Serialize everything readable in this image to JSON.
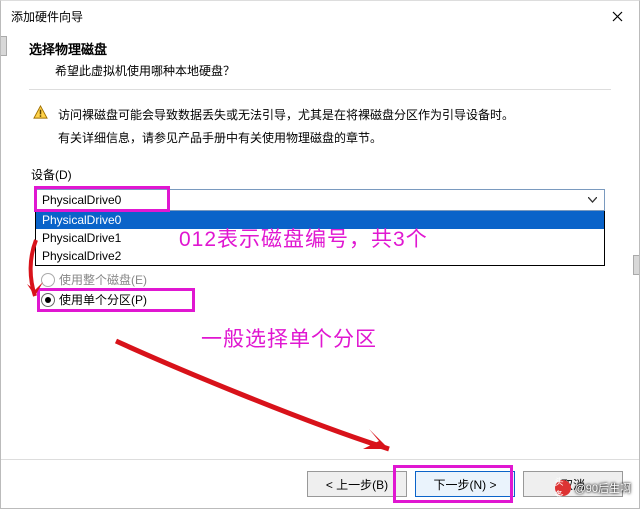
{
  "window": {
    "title": "添加硬件向导"
  },
  "header": {
    "heading": "选择物理磁盘",
    "subheading": "希望此虚拟机使用哪种本地硬盘？"
  },
  "warning": {
    "line1": "访问裸磁盘可能会导致数据丢失或无法引导，尤其是在将裸磁盘分区作为引导设备时。",
    "line2": "有关详细信息，请参见产品手册中有关使用物理磁盘的章节。"
  },
  "device": {
    "label": "设备(D)",
    "selected": "PhysicalDrive0",
    "options": [
      "PhysicalDrive0",
      "PhysicalDrive1",
      "PhysicalDrive2"
    ]
  },
  "usage": {
    "entire_label": "使用整个磁盘(E)",
    "single_label": "使用单个分区(P)",
    "selected": "single"
  },
  "annotations": {
    "combo_note": "012表示磁盘编号，共3个",
    "radio_note": "一般选择单个分区"
  },
  "footer": {
    "back": "< 上一步(B)",
    "next": "下一步(N) >",
    "cancel": "取消"
  },
  "watermark": {
    "icon_text": "头条",
    "author": "@90后生啊"
  },
  "colors": {
    "highlight": "#e017d1",
    "selection": "#0a63c9",
    "arrow": "#d8121a"
  }
}
